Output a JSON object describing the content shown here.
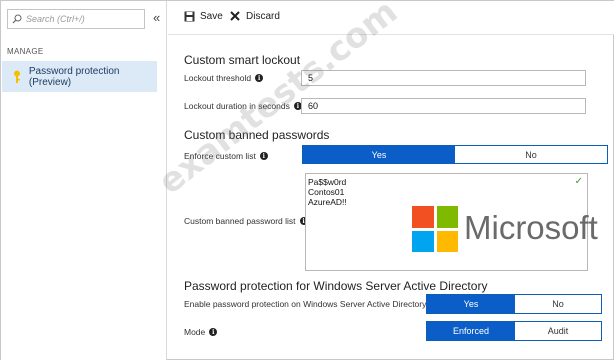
{
  "sidebar": {
    "search_placeholder": "Search (Ctrl+/)",
    "collapse_glyph": "«",
    "section_title": "MANAGE",
    "items": [
      {
        "label": "Password protection (Preview)",
        "icon": "key-icon"
      }
    ]
  },
  "toolbar": {
    "save_label": "Save",
    "discard_label": "Discard"
  },
  "lockout": {
    "heading": "Custom smart lockout",
    "threshold_label": "Lockout threshold",
    "threshold_value": "5",
    "duration_label": "Lockout duration in seconds",
    "duration_value": "60"
  },
  "banned": {
    "heading": "Custom banned passwords",
    "enforce_label": "Enforce custom list",
    "enforce_yes": "Yes",
    "enforce_no": "No",
    "enforce_selected": "Yes",
    "list_label": "Custom banned password list",
    "list_values": [
      "Pa$$w0rd",
      "Contos01",
      "AzureAD!!"
    ]
  },
  "windows_ad": {
    "heading": "Password protection for Windows Server Active Directory",
    "enable_label": "Enable password protection on Windows Server Active Directory",
    "enable_yes": "Yes",
    "enable_no": "No",
    "enable_selected": "Yes",
    "mode_label": "Mode",
    "mode_enforced": "Enforced",
    "mode_audit": "Audit",
    "mode_selected": "Enforced"
  },
  "overlay": {
    "brand_text": "Microsoft",
    "watermark_text": "examtests.com"
  },
  "colors": {
    "toggle_on": "#0b5ec7",
    "nav_selected_bg": "#dce9f7",
    "ms_red": "#f25022",
    "ms_green": "#7fba00",
    "ms_blue": "#00a4ef",
    "ms_yellow": "#ffb900"
  }
}
